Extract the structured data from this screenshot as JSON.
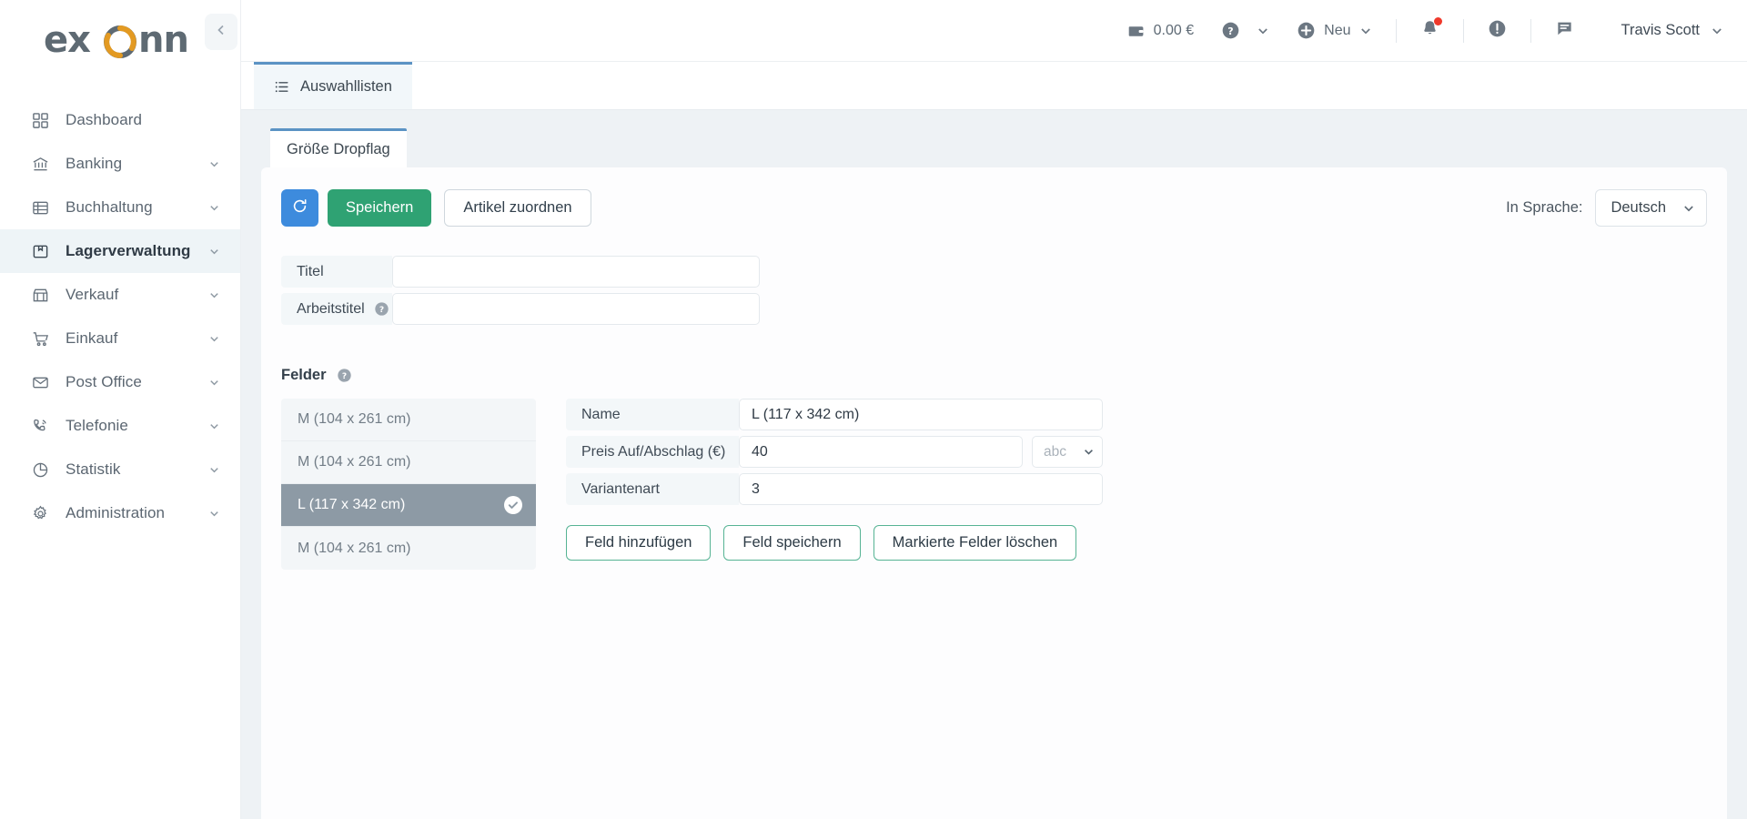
{
  "brand": {
    "logo_text": "exonn",
    "accent_blue": "#3d8bdd",
    "accent_green": "#2fa273",
    "accent_teal": "#56b394",
    "tab_blue": "#5b93c4",
    "selected_gray": "#8d9aa5"
  },
  "sidebar": {
    "collapse_icon": "chevron-left-icon",
    "items": [
      {
        "label": "Dashboard",
        "icon": "grid-icon",
        "has_chevron": false,
        "active": false
      },
      {
        "label": "Banking",
        "icon": "bank-icon",
        "has_chevron": true,
        "active": false
      },
      {
        "label": "Buchhaltung",
        "icon": "ledger-icon",
        "has_chevron": true,
        "active": false
      },
      {
        "label": "Lagerverwaltung",
        "icon": "box-icon",
        "has_chevron": true,
        "active": true
      },
      {
        "label": "Verkauf",
        "icon": "store-icon",
        "has_chevron": true,
        "active": false
      },
      {
        "label": "Einkauf",
        "icon": "cart-icon",
        "has_chevron": true,
        "active": false
      },
      {
        "label": "Post Office",
        "icon": "envelope-icon",
        "has_chevron": true,
        "active": false
      },
      {
        "label": "Telefonie",
        "icon": "phone-icon",
        "has_chevron": true,
        "active": false
      },
      {
        "label": "Statistik",
        "icon": "pie-chart-icon",
        "has_chevron": true,
        "active": false
      },
      {
        "label": "Administration",
        "icon": "gear-icon",
        "has_chevron": true,
        "active": false
      }
    ]
  },
  "topbar": {
    "wallet": {
      "icon": "wallet-icon",
      "amount": "0.00 €"
    },
    "help": {
      "icon": "question-circle-icon",
      "chevron": "chevron-down-icon"
    },
    "new": {
      "icon": "plus-circle-icon",
      "label": "Neu",
      "chevron": "chevron-down-icon"
    },
    "notifications": {
      "icon": "bell-icon",
      "has_unread_dot": true
    },
    "alerts": {
      "icon": "exclamation-circle-icon"
    },
    "messages": {
      "icon": "message-icon"
    },
    "user": {
      "name": "Travis Scott",
      "chevron": "chevron-down-icon"
    }
  },
  "module_tabs": [
    {
      "label": "Auswahllisten",
      "icon": "list-icon",
      "active": true
    }
  ],
  "card_tabs": [
    {
      "label": "Größe Dropflag",
      "active": true
    }
  ],
  "toolbar": {
    "refresh_icon": "refresh-icon",
    "save_label": "Speichern",
    "assign_label": "Artikel zuordnen",
    "language_label": "In Sprache:",
    "language_value": "Deutsch",
    "language_chevron": "chevron-down-icon"
  },
  "title_form": {
    "rows": [
      {
        "label": "Titel",
        "value": "",
        "placeholder": "",
        "help": false
      },
      {
        "label": "Arbeitstitel",
        "value": "",
        "placeholder": "",
        "help": true,
        "help_icon": "question-circle-icon"
      }
    ]
  },
  "felder": {
    "heading": "Felder",
    "help_icon": "question-circle-icon",
    "list": [
      {
        "label": "M (104 x 261 cm)",
        "selected": false
      },
      {
        "label": "M (104 x 261 cm)",
        "selected": false
      },
      {
        "label": "L (117 x 342 cm)",
        "selected": true,
        "check_icon": "check-circle-icon"
      },
      {
        "label": "M (104 x 261 cm)",
        "selected": false
      }
    ],
    "detail": {
      "name": {
        "label": "Name",
        "value": "L (117 x 342 cm)"
      },
      "price": {
        "label": "Preis Auf/Abschlag (€)",
        "value": "40",
        "unit_placeholder": "abc",
        "unit_chevron": "chevron-down-icon"
      },
      "variant": {
        "label": "Variantenart",
        "value": "3"
      }
    },
    "actions": [
      {
        "label": "Feld hinzufügen"
      },
      {
        "label": "Feld speichern"
      },
      {
        "label": "Markierte Felder löschen"
      }
    ]
  }
}
